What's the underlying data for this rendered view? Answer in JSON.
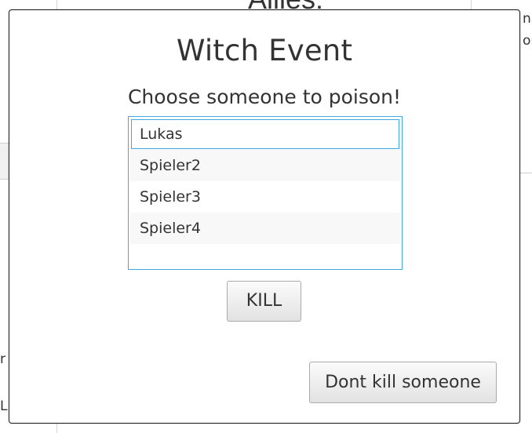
{
  "background": {
    "header_title": "Allies:",
    "right_fragments": [
      "na",
      "om"
    ],
    "left_fragments": [
      "r",
      "L"
    ]
  },
  "dialog": {
    "title": "Witch Event",
    "prompt": "Choose someone to poison!",
    "players": [
      "Lukas",
      "Spieler2",
      "Spieler3",
      "Spieler4"
    ],
    "selected_player": "Lukas",
    "kill_label": "KILL",
    "dont_kill_label": "Dont kill someone"
  },
  "colors": {
    "focus_accent": "#3ea9dd",
    "text": "#333333",
    "dialog_border": "#1e1e1e"
  }
}
